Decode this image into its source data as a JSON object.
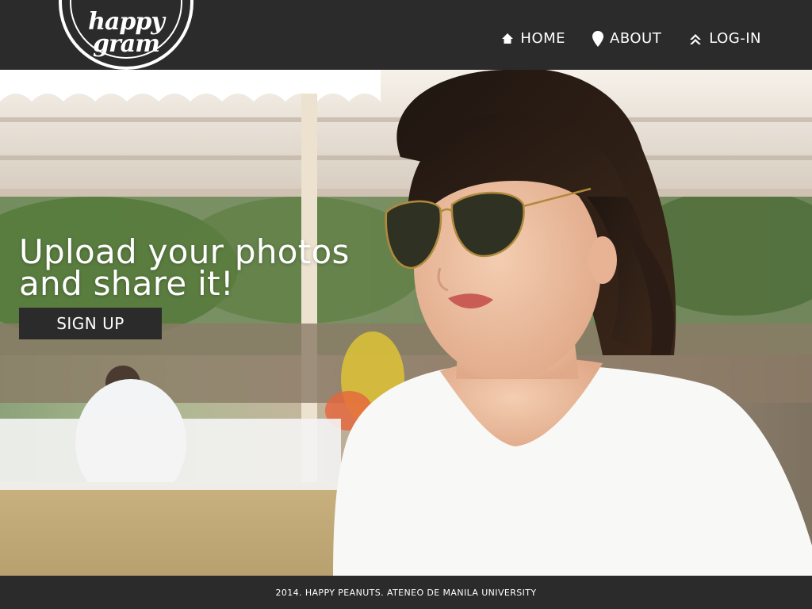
{
  "brand": {
    "logo_line1": "happy",
    "logo_line2": "gram"
  },
  "nav": {
    "items": [
      {
        "label": "HOME",
        "icon": "home-icon"
      },
      {
        "label": "ABOUT",
        "icon": "map-pin-icon"
      },
      {
        "label": "LOG-IN",
        "icon": "chevron-up-icon"
      }
    ]
  },
  "hero": {
    "headline_line1": "Upload your photos",
    "headline_line2": "and share it!",
    "cta_label": "SIGN UP"
  },
  "footer": {
    "text": "2014. HAPPY PEANUTS. ATENEO DE MANILA UNIVERSITY"
  },
  "colors": {
    "bar": "#2b2b2b",
    "text": "#ffffff"
  }
}
